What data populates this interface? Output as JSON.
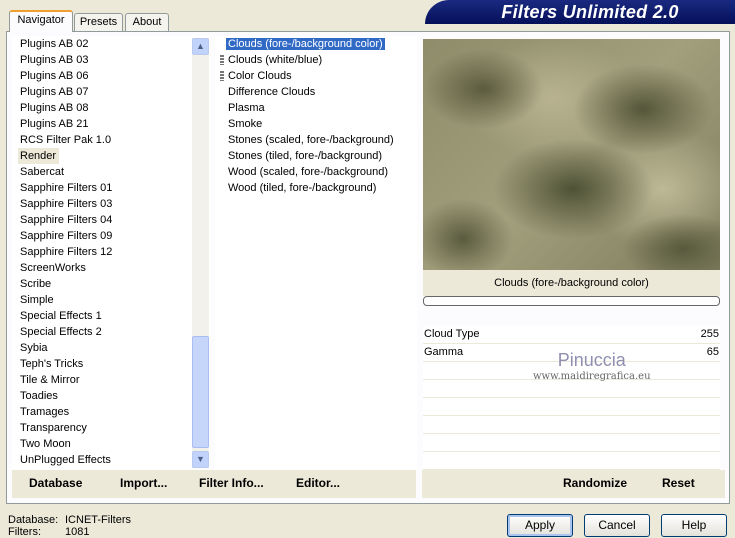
{
  "title": "Filters Unlimited 2.0",
  "tabs": [
    {
      "label": "Navigator",
      "active": true
    },
    {
      "label": "Presets"
    },
    {
      "label": "About"
    }
  ],
  "categories": [
    "Plugins AB 02",
    "Plugins AB 03",
    "Plugins AB 06",
    "Plugins AB 07",
    "Plugins AB 08",
    "Plugins AB 21",
    "RCS Filter Pak 1.0",
    "Render",
    "Sabercat",
    "Sapphire Filters 01",
    "Sapphire Filters 03",
    "Sapphire Filters 04",
    "Sapphire Filters 09",
    "Sapphire Filters 12",
    "ScreenWorks",
    "Scribe",
    "Simple",
    "Special Effects 1",
    "Special Effects 2",
    "Sybia",
    "Teph's Tricks",
    "Tile & Mirror",
    "Toadies",
    "Tramages",
    "Transparency",
    "Two Moon",
    "UnPlugged Effects"
  ],
  "selected_category": "Render",
  "filters": [
    "Clouds (fore-/background color)",
    "Clouds (white/blue)",
    "Color Clouds",
    "Difference Clouds",
    "Plasma",
    "Smoke",
    "Stones (scaled, fore-/background)",
    "Stones (tiled, fore-/background)",
    "Wood (scaled, fore-/background)",
    "Wood (tiled, fore-/background)"
  ],
  "selected_filter": "Clouds (fore-/background color)",
  "preview_caption": "Clouds (fore-/background color)",
  "params": [
    {
      "label": "Cloud Type",
      "value": "255"
    },
    {
      "label": "Gamma",
      "value": "65"
    }
  ],
  "bottom_left": {
    "database": "Database",
    "import": "Import...",
    "filter_info": "Filter Info...",
    "editor": "Editor..."
  },
  "bottom_right": {
    "randomize": "Randomize",
    "reset": "Reset"
  },
  "status": {
    "database_label": "Database:",
    "database_value": "ICNET-Filters",
    "filters_label": "Filters:",
    "filters_value": "1081"
  },
  "buttons": {
    "apply": "Apply",
    "cancel": "Cancel",
    "help": "Help"
  },
  "watermark": {
    "name": "Pinuccia",
    "url": "www.maidiregrafica.eu"
  }
}
